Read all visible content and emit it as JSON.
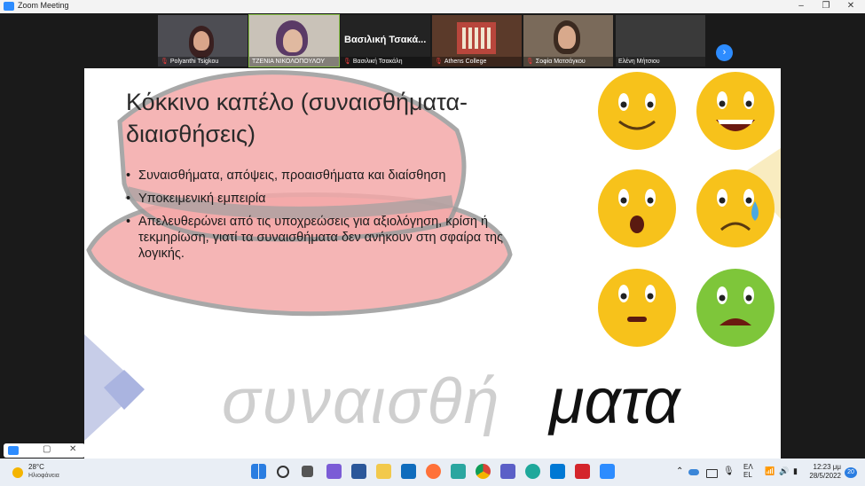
{
  "window": {
    "title": "Zoom Meeting"
  },
  "participants": [
    {
      "name": "Polyanthi Tsigkou",
      "muted": true
    },
    {
      "name": "ΤΖΕΝΙΑ ΝΙΚΟΛΟΠΟΥΛΟΥ",
      "muted": false
    },
    {
      "name": "Βασιλική Τσακάλη",
      "display": "Βασιλική Τσακά...",
      "muted": true
    },
    {
      "name": "Athens College",
      "muted": true
    },
    {
      "name": "Σοφία Ματσάγκου",
      "muted": true
    },
    {
      "name": "Ελένη Μήτσιου",
      "muted": false
    }
  ],
  "slide": {
    "title_line1": "Κόκκινο καπέλο (συναισθήματα-",
    "title_line2": "διαισθήσεις)",
    "bullets": [
      "Συναισθήματα, απόψεις, προαισθήματα και  διαίσθηση",
      " Υποκειμενική εμπειρία",
      "Απελευθερώνει από τις υποχρεώσεις για αξιολόγηση, κρίση ή τεκμηρίωση, γιατί τα συναισθήματα δεν ανήκουν στη σφαίρα της λογικής."
    ],
    "big_word_gray": "συναισθή",
    "big_word_black": "ματα"
  },
  "taskbar": {
    "weather_temp": "28°C",
    "weather_desc": "Ηλιοφάνεια",
    "language": "ΕΛ",
    "language2": "EL",
    "time": "12:23 μμ",
    "date": "28/5/2022",
    "notifications": "20"
  },
  "colors": {
    "zoom_blue": "#2d8cff",
    "hat_red": "#f4a9a9",
    "smiley_yellow": "#f7c21b",
    "smiley_green": "#7ec63a"
  }
}
